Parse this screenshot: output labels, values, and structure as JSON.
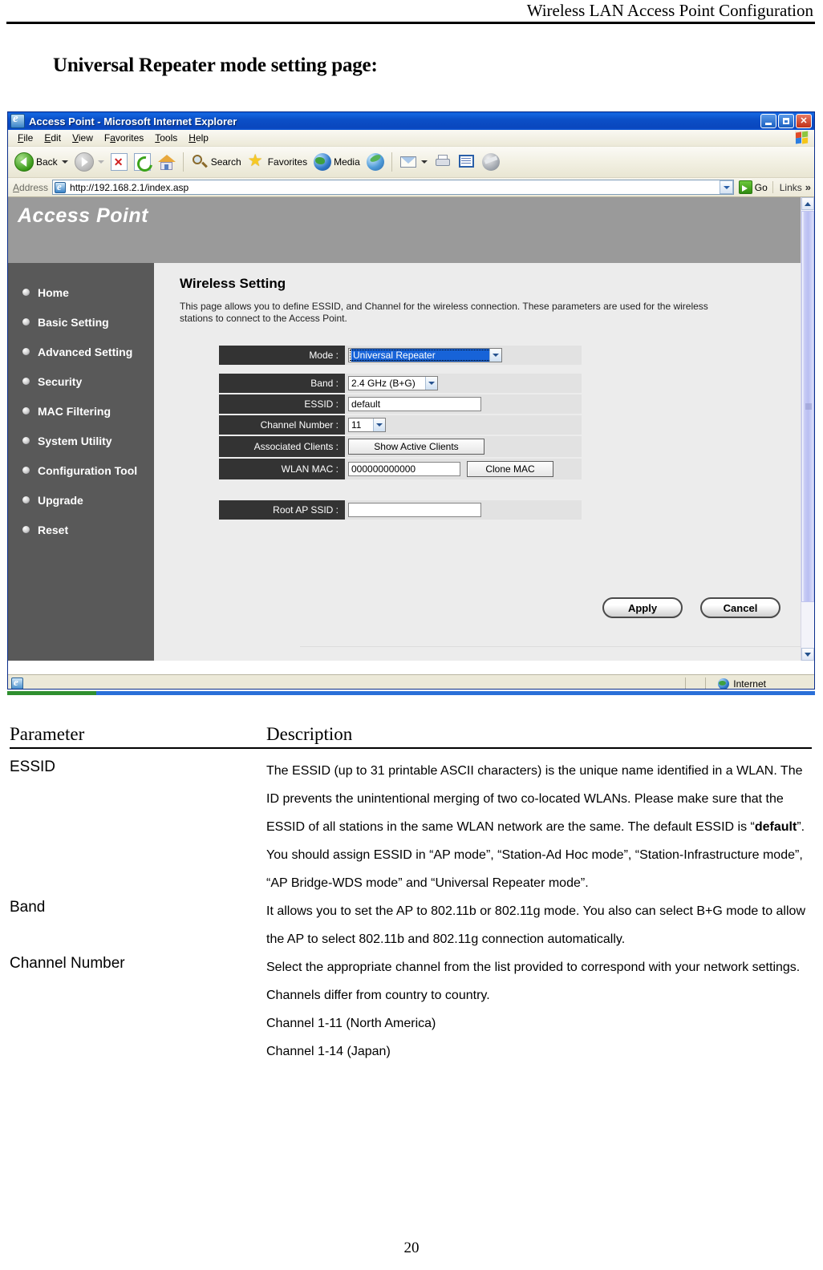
{
  "document": {
    "header_title": "Wireless LAN Access Point Configuration",
    "page_heading": "Universal Repeater mode setting page:",
    "page_number": "20"
  },
  "browser": {
    "title": "Access Point - Microsoft Internet Explorer",
    "window_controls": {
      "minimize": "Minimize",
      "maximize": "Restore",
      "close": "Close"
    },
    "menu": [
      {
        "label": "File",
        "accel": "F"
      },
      {
        "label": "Edit",
        "accel": "E"
      },
      {
        "label": "View",
        "accel": "V"
      },
      {
        "label": "Favorites",
        "accel": "a"
      },
      {
        "label": "Tools",
        "accel": "T"
      },
      {
        "label": "Help",
        "accel": "H"
      }
    ],
    "toolbar": {
      "back": "Back",
      "forward": "Forward",
      "stop": "Stop",
      "refresh": "Refresh",
      "home": "Home",
      "search": "Search",
      "favorites": "Favorites",
      "media": "Media",
      "history": "History",
      "mail": "Mail",
      "print": "Print",
      "edit": "Edit",
      "messenger": "Messenger"
    },
    "address": {
      "label": "Address",
      "url": "http://192.168.2.1/index.asp",
      "go": "Go",
      "links": "Links"
    },
    "status": {
      "zone": "Internet"
    }
  },
  "app": {
    "banner_title": "Access Point",
    "sidebar": {
      "items": [
        {
          "label": "Home"
        },
        {
          "label": "Basic Setting"
        },
        {
          "label": "Advanced Setting"
        },
        {
          "label": "Security"
        },
        {
          "label": "MAC Filtering"
        },
        {
          "label": "System Utility"
        },
        {
          "label": "Configuration Tool"
        },
        {
          "label": "Upgrade"
        },
        {
          "label": "Reset"
        }
      ]
    },
    "main": {
      "title": "Wireless Setting",
      "description": "This page allows you to define ESSID, and Channel for the wireless connection. These parameters are used for the wireless stations to connect to the Access Point.",
      "fields": {
        "mode": {
          "label": "Mode :",
          "value": "Universal Repeater"
        },
        "band": {
          "label": "Band :",
          "value": "2.4 GHz (B+G)"
        },
        "essid": {
          "label": "ESSID :",
          "value": "default"
        },
        "channel": {
          "label": "Channel Number :",
          "value": "11"
        },
        "associated_clients": {
          "label": "Associated Clients :",
          "button": "Show Active Clients"
        },
        "wlan_mac": {
          "label": "WLAN MAC :",
          "value": "000000000000",
          "button": "Clone MAC"
        },
        "root_ap_ssid": {
          "label": "Root AP SSID :",
          "value": ""
        }
      },
      "buttons": {
        "apply": "Apply",
        "cancel": "Cancel"
      }
    }
  },
  "parameter_table": {
    "headers": {
      "parameter": "Parameter",
      "description": "Description"
    },
    "rows": [
      {
        "parameter": "ESSID",
        "description_html": "The ESSID (up to 31 printable ASCII characters) is the unique name identified in a WLAN. The ID prevents the unintentional merging of two co-located WLANs. Please make sure that the ESSID of all stations in the same WLAN network are the same. The default ESSID is “<b>default</b>”. You should assign ESSID in “AP mode”, “Station-Ad Hoc mode”, “Station-Infrastructure mode”, “AP Bridge-WDS mode” and “Universal Repeater mode”."
      },
      {
        "parameter": "Band",
        "description_html": "It allows you to set the AP to 802.11b or 802.11g mode. You also can select B+G mode to allow the AP to select 802.11b and 802.11g connection automatically."
      },
      {
        "parameter": "Channel Number",
        "description_html": "Select the appropriate channel from the list provided to correspond with your network settings. Channels differ from country to country.<br>Channel 1-11 (North America)<br>Channel 1-14 (Japan)"
      }
    ]
  }
}
